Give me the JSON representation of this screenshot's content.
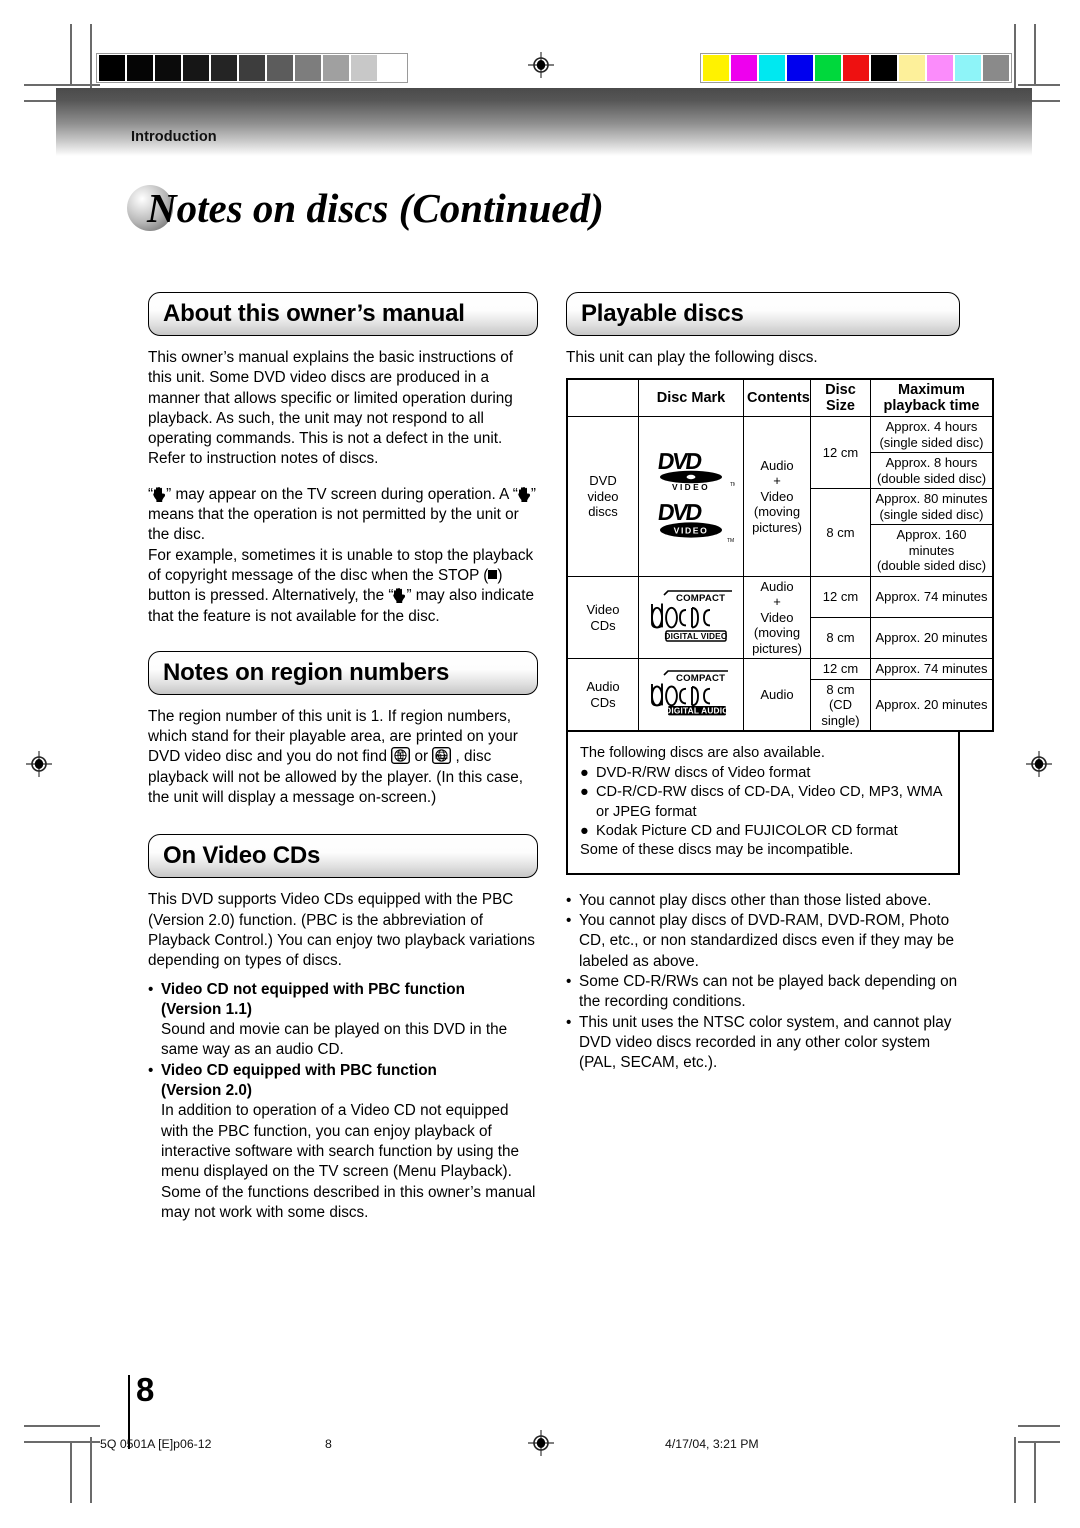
{
  "document": {
    "kicker": "Introduction",
    "title": "Notes on discs (Continued)",
    "page_number": "8"
  },
  "left_column": {
    "manual": {
      "heading": "About this owner’s manual",
      "para1": "This owner’s manual explains the basic instructions of this unit. Some DVD video discs are produced in a manner that allows specific or limited operation during playback. As such, the unit may not respond to all operating commands. This is not a defect in the unit. Refer to instruction notes of discs.",
      "para2_a": "“",
      "para2_b": "” may appear on the TV screen during operation. A “",
      "para2_c": "” means that the operation is not permitted by the unit or the disc.",
      "para3_a": "For example, sometimes it is unable to stop the playback of copyright message of the disc when the STOP (",
      "para3_b": ") button is pressed. Alternatively, the “",
      "para3_c": "” may also indicate that the feature is not available for the disc."
    },
    "region": {
      "heading": "Notes on region numbers",
      "para_a": "The region number of this unit is 1. If region numbers, which stand for their playable area, are printed on your DVD video disc and you do not find ",
      "para_b": " or ",
      "para_c": " , disc playback will not be allowed by the player. (In this case, the unit will display a message on-screen.)",
      "icon1_label": "1",
      "icon2_label": "ALL"
    },
    "videocd": {
      "heading": "On Video CDs",
      "para1": "This DVD supports Video CDs equipped with the PBC (Version 2.0) function. (PBC is the abbreviation of Playback Control.) You can enjoy two playback variations depending on types of discs.",
      "bullets": [
        {
          "bold_line1": "Video CD not equipped with PBC function",
          "bold_line2": "(Version 1.1)",
          "body": "Sound and movie can be played on this DVD in the same way as an audio CD."
        },
        {
          "bold_line1": "Video CD equipped with PBC function",
          "bold_line2": "(Version 2.0)",
          "body": "In addition to operation of a Video CD not equipped with the PBC function, you can enjoy playback of interactive software with search function by using the menu displayed on the TV screen (Menu Playback). Some of the functions described in this owner’s manual may not work with some discs."
        }
      ]
    }
  },
  "right_column": {
    "heading": "Playable discs",
    "intro": "This unit can play the following discs.",
    "table": {
      "headers": [
        "",
        "Disc Mark",
        "Contents",
        "Disc Size",
        "Maximum playback time"
      ],
      "rows": [
        {
          "name": "DVD video discs",
          "name_lines": [
            "DVD",
            "video",
            "discs"
          ],
          "marks": [
            "dvd-video-logo",
            "dvd-video-logo-alt"
          ],
          "contents": [
            "Audio",
            "+",
            "Video",
            "(moving",
            "pictures)"
          ],
          "sizes": [
            {
              "size": "12 cm",
              "times": [
                "Approx. 4 hours (single sided disc)",
                "Approx. 8 hours (double sided disc)"
              ]
            },
            {
              "size": "8 cm",
              "times": [
                "Approx. 80 minutes (single sided disc)",
                "Approx. 160 minutes (double sided disc)"
              ]
            }
          ]
        },
        {
          "name": "Video CDs",
          "name_lines": [
            "Video",
            "CDs"
          ],
          "marks": [
            "compact-disc-digital-video-logo"
          ],
          "contents": [
            "Audio",
            "+",
            "Video",
            "(moving",
            "pictures)"
          ],
          "sizes": [
            {
              "size": "12 cm",
              "times": [
                "Approx. 74 minutes"
              ]
            },
            {
              "size": "8 cm",
              "times": [
                "Approx. 20 minutes"
              ]
            }
          ]
        },
        {
          "name": "Audio CDs",
          "name_lines": [
            "Audio",
            "CDs"
          ],
          "marks": [
            "compact-disc-digital-audio-logo"
          ],
          "contents": [
            "Audio"
          ],
          "sizes": [
            {
              "size": "12 cm",
              "times": [
                "Approx. 74 minutes"
              ]
            },
            {
              "size": "8 cm (CD single)",
              "times": [
                "Approx. 20 minutes"
              ]
            }
          ]
        }
      ]
    },
    "also_available": {
      "intro": "The following discs are also available.",
      "items": [
        "DVD-R/RW discs of Video format",
        "CD-R/CD-RW discs of CD-DA, Video CD, MP3, WMA or JPEG format",
        "Kodak Picture CD and FUJICOLOR CD format"
      ],
      "outro": "Some of these discs may be incompatible."
    },
    "notes": [
      "You cannot play discs other than those listed above.",
      "You cannot play discs of DVD-RAM, DVD-ROM, Photo CD, etc., or non standardized discs even if they may be labeled as above.",
      "Some CD-R/RWs can not be played back depending on the recording conditions.",
      "This unit uses the NTSC color system, and cannot play DVD video discs recorded in any other color system (PAL, SECAM, etc.)."
    ]
  },
  "logo_text": {
    "dvd": "DVD",
    "video": "V I D E O",
    "video_tight": "VIDEO",
    "tm": "TM",
    "compact": "COMPACT",
    "disc": "disc",
    "digital_video": "DIGITAL VIDEO",
    "digital_audio": "DIGITAL AUDIO"
  },
  "footer": {
    "job_code": "5Q  0501A [E]p06-12",
    "page": "8",
    "timestamp": "4/17/04, 3:21 PM"
  },
  "print_marks": {
    "grayscale_steps": [
      "#000000",
      "#050505",
      "#0b0b0b",
      "#161616",
      "#242424",
      "#3d3d3d",
      "#5c5c5c",
      "#7d7d7d",
      "#a0a0a0",
      "#c8c8c8",
      "#ffffff"
    ],
    "color_steps": [
      "#fff200",
      "#ee00ee",
      "#00e8f0",
      "#0000ee",
      "#00d83c",
      "#ee1111",
      "#000000",
      "#fdf09a",
      "#fb8cfb",
      "#8ef4f8",
      "#8a8a8a"
    ]
  }
}
